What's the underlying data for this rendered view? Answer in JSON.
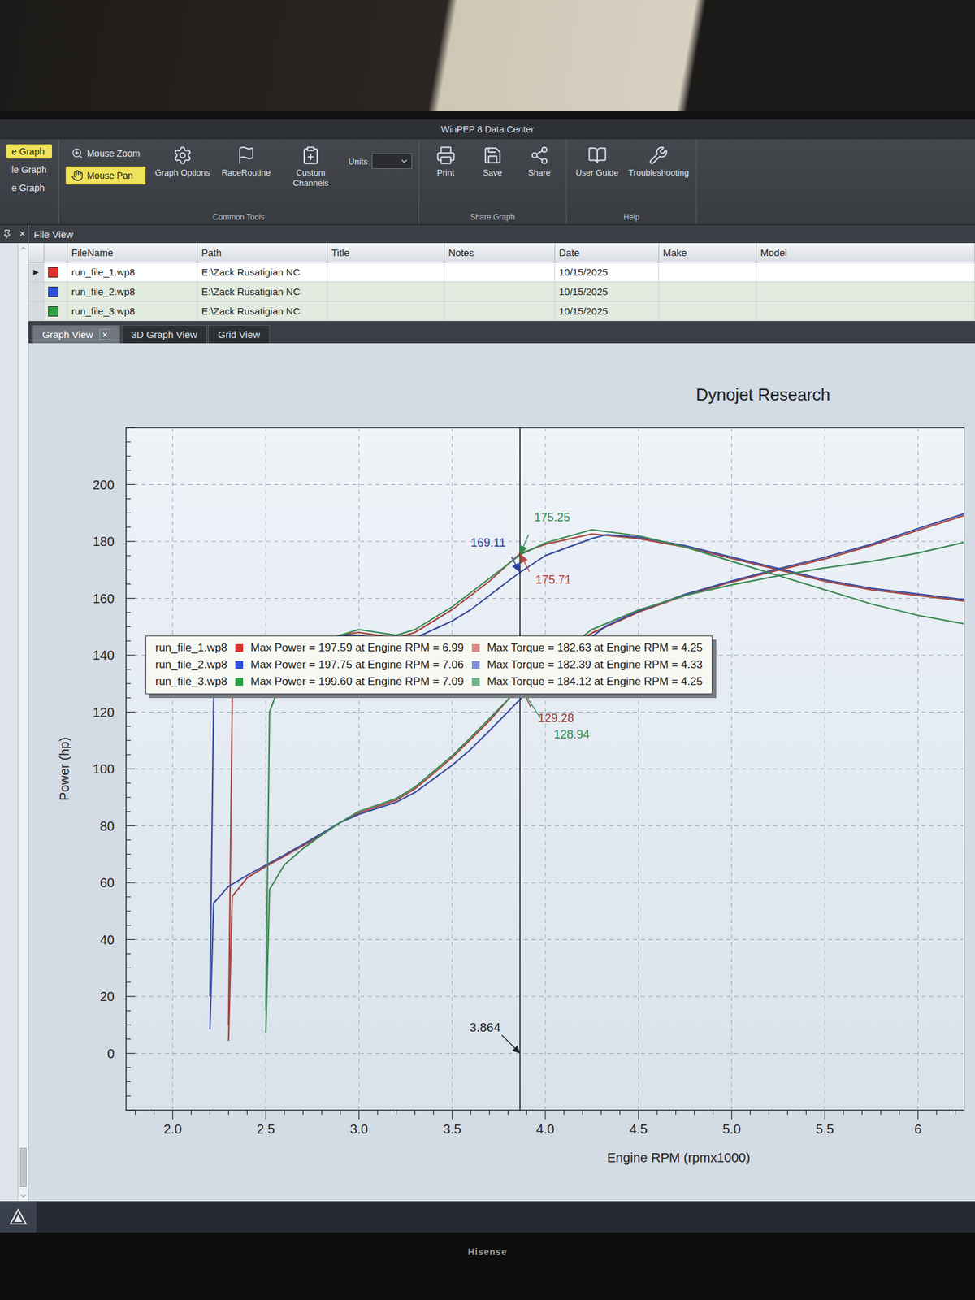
{
  "window": {
    "title": "WinPEP 8 Data Center"
  },
  "ribbon": {
    "graph_modes": [
      {
        "label": "e Graph",
        "selected": true
      },
      {
        "label": "le Graph",
        "selected": false
      },
      {
        "label": "e Graph",
        "selected": false
      }
    ],
    "mouse_tools": [
      {
        "label": "Mouse Zoom",
        "selected": false
      },
      {
        "label": "Mouse Pan",
        "selected": true
      }
    ],
    "common_tools": {
      "label": "Common Tools",
      "buttons": [
        "Graph Options",
        "RaceRoutine",
        "Custom Channels"
      ],
      "units_label": "Units"
    },
    "share_graph": {
      "label": "Share Graph",
      "buttons": [
        "Print",
        "Save",
        "Share"
      ]
    },
    "help": {
      "label": "Help",
      "buttons": [
        "User Guide",
        "Troubleshooting"
      ]
    }
  },
  "side_panel": {
    "close": "×"
  },
  "file_view": {
    "title": "File View",
    "columns": [
      "FileName",
      "Path",
      "Title",
      "Notes",
      "Date",
      "Make",
      "Model"
    ],
    "rows": [
      {
        "marker": "▶",
        "color": "#d9342b",
        "file": "run_file_1.wp8",
        "path": "E:\\Zack Rusatigian NC",
        "title": "",
        "notes": "",
        "date": "10/15/2025",
        "make": "",
        "model": "",
        "selected": true
      },
      {
        "marker": "",
        "color": "#2f4fd8",
        "file": "run_file_2.wp8",
        "path": "E:\\Zack Rusatigian NC",
        "title": "",
        "notes": "",
        "date": "10/15/2025",
        "make": "",
        "model": "",
        "selected": false
      },
      {
        "marker": "",
        "color": "#2e9e47",
        "file": "run_file_3.wp8",
        "path": "E:\\Zack Rusatigian NC",
        "title": "",
        "notes": "",
        "date": "10/15/2025",
        "make": "",
        "model": "",
        "selected": false
      }
    ]
  },
  "tabs": [
    {
      "label": "Graph View",
      "selected": true,
      "close": "×"
    },
    {
      "label": "3D Graph View",
      "selected": false,
      "close": ""
    },
    {
      "label": "Grid View",
      "selected": false,
      "close": ""
    }
  ],
  "chart": {
    "title": "Dynojet Research",
    "y_axis": {
      "label": "Power (hp)",
      "ticks": [
        "0",
        "20",
        "40",
        "60",
        "80",
        "100",
        "120",
        "140",
        "160",
        "180",
        "200"
      ]
    },
    "x_axis": {
      "label": "Engine RPM (rpmx1000)",
      "ticks": [
        "2.0",
        "2.5",
        "3.0",
        "3.5",
        "4.0",
        "4.5",
        "5.0",
        "5.5",
        "6"
      ]
    },
    "cursor": {
      "rpm": 3.864,
      "label": "3.864"
    },
    "markers": [
      {
        "label": "169.11",
        "value": 169.11,
        "color": "#2f3f9e"
      },
      {
        "label": "175.25",
        "value": 175.25,
        "color": "#2e8a4f"
      },
      {
        "label": "175.71",
        "value": 175.71,
        "color": "#b5433b"
      },
      {
        "label": "129.28",
        "value": 129.28,
        "color": "#8a3a32"
      },
      {
        "label": "128.94",
        "value": 128.94,
        "color": "#2e8a4f"
      }
    ],
    "series": [
      {
        "run": "run_file_1.wp8",
        "quantity": "torque",
        "color": "#a8433d",
        "rpm": [
          2.3,
          2.32,
          2.4,
          2.5,
          2.6,
          2.7,
          2.8,
          2.9,
          3.0,
          3.1,
          3.2,
          3.3,
          3.4,
          3.5,
          3.6,
          3.7,
          3.8,
          3.864,
          4.0,
          4.25,
          4.5,
          4.75,
          5.0,
          5.25,
          5.5,
          5.75,
          6.0,
          6.25
        ],
        "values": [
          10,
          125,
          135,
          138,
          140,
          142,
          144,
          147,
          148,
          147,
          146,
          148,
          152,
          156,
          161,
          166,
          172,
          175.71,
          179,
          182.63,
          181,
          178,
          174,
          170,
          166,
          163,
          161,
          159
        ]
      },
      {
        "run": "run_file_1.wp8",
        "quantity": "power",
        "color": "#a8433d",
        "rpm": [
          2.3,
          2.32,
          2.4,
          2.5,
          2.6,
          2.7,
          2.8,
          2.9,
          3.0,
          3.1,
          3.2,
          3.3,
          3.4,
          3.5,
          3.6,
          3.7,
          3.8,
          3.864,
          4.0,
          4.25,
          4.5,
          4.75,
          5.0,
          5.25,
          5.5,
          5.75,
          6.0,
          6.25
        ],
        "values": [
          4.4,
          55.2,
          61.7,
          65.7,
          69.3,
          73.0,
          76.8,
          81.2,
          84.5,
          86.8,
          89.0,
          93.0,
          98.4,
          104.0,
          110.4,
          116.9,
          124.4,
          129.28,
          136.3,
          147.8,
          155.1,
          161.0,
          165.7,
          169.9,
          173.8,
          178.5,
          183.9,
          189.2
        ]
      },
      {
        "run": "run_file_2.wp8",
        "quantity": "torque",
        "color": "#3a4c9e",
        "rpm": [
          2.2,
          2.22,
          2.3,
          2.4,
          2.5,
          2.6,
          2.7,
          2.8,
          2.9,
          3.0,
          3.1,
          3.2,
          3.3,
          3.4,
          3.5,
          3.6,
          3.7,
          3.8,
          3.864,
          4.0,
          4.25,
          4.33,
          4.5,
          4.75,
          5.0,
          5.25,
          5.5,
          5.75,
          6.0,
          6.25
        ],
        "values": [
          20,
          125,
          134,
          137,
          139,
          141,
          143,
          145,
          147,
          147,
          146,
          145,
          146,
          149,
          152,
          156,
          161,
          166,
          169.11,
          175,
          181,
          182.39,
          181.5,
          178.5,
          174.5,
          170.5,
          166.5,
          163.5,
          161.5,
          159.5
        ]
      },
      {
        "run": "run_file_2.wp8",
        "quantity": "power",
        "color": "#3a4c9e",
        "rpm": [
          2.2,
          2.22,
          2.3,
          2.4,
          2.5,
          2.6,
          2.7,
          2.8,
          2.9,
          3.0,
          3.1,
          3.2,
          3.3,
          3.4,
          3.5,
          3.6,
          3.7,
          3.8,
          3.864,
          4.0,
          4.25,
          4.33,
          4.5,
          4.75,
          5.0,
          5.25,
          5.5,
          5.75,
          6.0,
          6.25
        ],
        "values": [
          8.4,
          52.8,
          58.7,
          62.6,
          66.2,
          69.8,
          73.5,
          77.3,
          81.2,
          84.0,
          86.2,
          88.3,
          91.7,
          96.5,
          101.3,
          106.9,
          113.4,
          120.1,
          124.4,
          133.3,
          146.5,
          150.4,
          155.5,
          161.4,
          166.1,
          170.4,
          174.4,
          179.0,
          184.5,
          189.8
        ]
      },
      {
        "run": "run_file_3.wp8",
        "quantity": "torque",
        "color": "#3d8a56",
        "rpm": [
          2.5,
          2.52,
          2.6,
          2.7,
          2.8,
          2.9,
          3.0,
          3.1,
          3.2,
          3.3,
          3.4,
          3.5,
          3.6,
          3.7,
          3.8,
          3.864,
          4.0,
          4.25,
          4.5,
          4.75,
          5.0,
          5.25,
          5.5,
          5.75,
          6.0,
          6.25
        ],
        "values": [
          15,
          120,
          134,
          140,
          144,
          147,
          149,
          148,
          147,
          149,
          153,
          157,
          162,
          167,
          172,
          175.25,
          179.5,
          184.12,
          182,
          178,
          173,
          168,
          163,
          158,
          154,
          151
        ]
      },
      {
        "run": "run_file_3.wp8",
        "quantity": "power",
        "color": "#3d8a56",
        "rpm": [
          2.5,
          2.52,
          2.6,
          2.7,
          2.8,
          2.9,
          3.0,
          3.1,
          3.2,
          3.3,
          3.4,
          3.5,
          3.6,
          3.7,
          3.8,
          3.864,
          4.0,
          4.25,
          4.5,
          4.75,
          5.0,
          5.25,
          5.5,
          5.75,
          6.0,
          6.25
        ],
        "values": [
          7.1,
          57.6,
          66.3,
          72.0,
          76.8,
          81.2,
          85.1,
          87.3,
          89.6,
          93.6,
          99.1,
          104.6,
          111.1,
          117.7,
          124.4,
          128.94,
          136.7,
          149.0,
          155.9,
          161.0,
          164.7,
          167.9,
          170.7,
          173.0,
          175.9,
          179.7
        ]
      }
    ],
    "legend": [
      {
        "file": "run_file_1.wp8",
        "color": "#d9342b",
        "max_power": "Max Power = 197.59 at Engine RPM = 6.99",
        "torque_color": "#d98a84",
        "max_torque": "Max Torque = 182.63 at Engine RPM = 4.25"
      },
      {
        "file": "run_file_2.wp8",
        "color": "#2f4fd8",
        "max_power": "Max Power = 197.75 at Engine RPM = 7.06",
        "torque_color": "#7f8fd9",
        "max_torque": "Max Torque = 182.39 at Engine RPM = 4.33"
      },
      {
        "file": "run_file_3.wp8",
        "color": "#2e9e47",
        "max_power": "Max Power = 199.60 at Engine RPM = 7.09",
        "torque_color": "#6fb585",
        "max_torque": "Max Torque = 184.12 at Engine RPM = 4.25"
      }
    ]
  },
  "monitor": {
    "brand": "Hisense"
  }
}
